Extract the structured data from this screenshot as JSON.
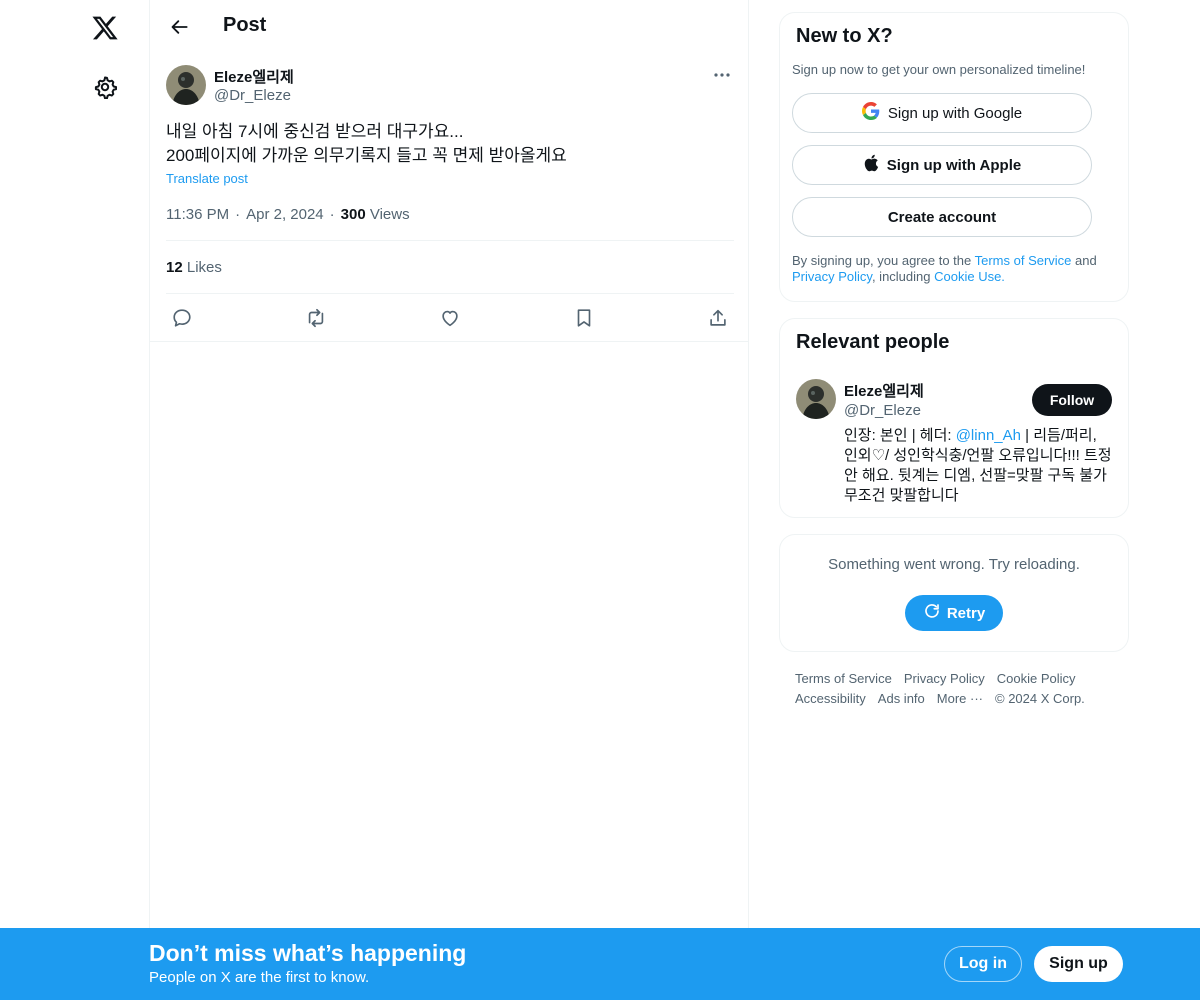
{
  "nav": {
    "logo_icon": "x-logo-icon",
    "settings_icon": "gear-icon"
  },
  "header": {
    "title": "Post"
  },
  "post": {
    "author_name": "Eleze엘리제",
    "author_handle": "@Dr_Eleze",
    "text_line1": "내일 아침 7시에 중신검 받으러 대구가요...",
    "text_line2": "200페이지에 가까운 의무기록지 들고 꼭 면제 받아올게요",
    "translate_label": "Translate post",
    "time": "11:36 PM",
    "date": "Apr 2, 2024",
    "views_count": "300",
    "views_label": "Views",
    "likes_count": "12",
    "likes_label": "Likes"
  },
  "signup_card": {
    "title": "New to X?",
    "subtitle": "Sign up now to get your own personalized timeline!",
    "google_label": "Sign up with Google",
    "apple_label": "Sign up with Apple",
    "create_label": "Create account",
    "legal_prefix": "By signing up, you agree to the ",
    "terms_link": "Terms of Service",
    "legal_and": " and ",
    "privacy_link": "Privacy Policy",
    "legal_including": ", including ",
    "cookie_link": "Cookie Use."
  },
  "relevant_people": {
    "title": "Relevant people",
    "name": "Eleze엘리제",
    "handle": "@Dr_Eleze",
    "follow_label": "Follow",
    "bio_prefix": "인장: 본인 | 헤더: ",
    "bio_mention": "@linn_Ah",
    "bio_suffix": " | 리듬/퍼리, 인외♡/ 성인학식충/언팔 오류입니다!!! 트정 안 해요. 뒷계는 디엠, 선팔=맞팔 구독 불가 무조건 맞팔합니다"
  },
  "error_card": {
    "message": "Something went wrong. Try reloading.",
    "retry_label": "Retry"
  },
  "footer": {
    "terms": "Terms of Service",
    "privacy": "Privacy Policy",
    "cookie": "Cookie Policy",
    "accessibility": "Accessibility",
    "ads": "Ads info",
    "more": "More ···",
    "copyright": "© 2024 X Corp."
  },
  "banner": {
    "title": "Don’t miss what’s happening",
    "subtitle": "People on X are the first to know.",
    "login_label": "Log in",
    "signup_label": "Sign up"
  },
  "colors": {
    "accent": "#1d9bf0",
    "text": "#0f1419",
    "muted": "#536471",
    "border": "#eff3f4"
  }
}
